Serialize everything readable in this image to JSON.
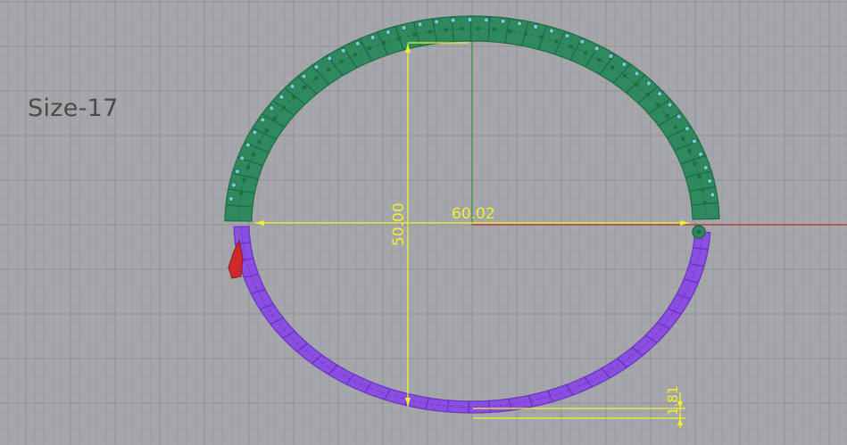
{
  "viewport": {
    "size_label": "Size-17",
    "background": "#a6a7ab",
    "grid_minor_color": "#9b9ca0",
    "grid_major_color": "#8f9095",
    "x_axis_color": "#b0302a",
    "y_axis_color": "#2f8a3f"
  },
  "model": {
    "upper_half_color": "#2e8a5e",
    "upper_half_shade": "#1f6b46",
    "stone_color": "#7fc6d9",
    "lower_half_color": "#8a4fe0",
    "lower_half_shade": "#6a33c2",
    "clasp_color": "#d0282c"
  },
  "dimensions": {
    "color": "#f0f030",
    "width_value": "60.02",
    "height_value": "50.00",
    "thickness_value": "1.81"
  }
}
